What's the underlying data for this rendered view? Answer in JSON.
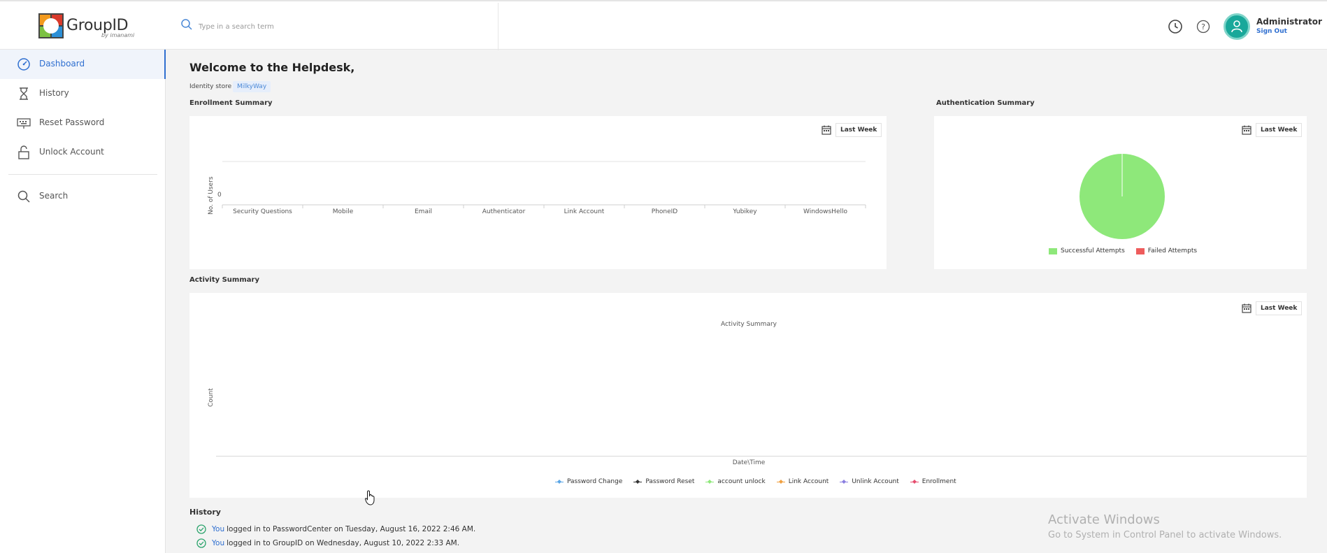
{
  "brand": {
    "name": "GroupID",
    "by": "by imanami"
  },
  "search": {
    "placeholder": "Type in a search term"
  },
  "user": {
    "name": "Administrator",
    "sign_out": "Sign Out"
  },
  "icons": {
    "history": "clock-icon",
    "help": "help-icon",
    "avatar": "user-icon"
  },
  "colors": {
    "accent": "#2f6fd0",
    "success": "#8ee87a",
    "failed": "#ee5c5c",
    "avatar": "#19a89a"
  },
  "sidebar": {
    "items": [
      {
        "label": "Dashboard",
        "icon": "dashboard-icon",
        "active": true
      },
      {
        "label": "History",
        "icon": "hourglass-icon",
        "active": false
      },
      {
        "label": "Reset Password",
        "icon": "keyboard-icon",
        "active": false
      },
      {
        "label": "Unlock Account",
        "icon": "unlock-icon",
        "active": false
      },
      {
        "label": "Search",
        "icon": "search-icon",
        "active": false
      }
    ]
  },
  "main": {
    "title": "Welcome to the Helpdesk,",
    "identity_store_label": "Identity store",
    "identity_store_value": "MilkyWay"
  },
  "enrollment": {
    "title": "Enrollment Summary",
    "range": "Last Week"
  },
  "authentication": {
    "title": "Authentication Summary",
    "range": "Last Week"
  },
  "activity": {
    "title": "Activity Summary",
    "range": "Last Week"
  },
  "chart_data": [
    {
      "type": "bar",
      "title": "",
      "ylabel": "No. of Users",
      "xlabel": "",
      "categories": [
        "Security Questions",
        "Mobile",
        "Email",
        "Authenticator",
        "Link Account",
        "PhoneID",
        "Yubikey",
        "WindowsHello"
      ],
      "values": [
        0,
        0,
        0,
        0,
        0,
        0,
        0,
        0
      ],
      "yticks": [
        "0"
      ]
    },
    {
      "type": "pie",
      "title": "",
      "labels": [
        "Successful Attempts",
        "Failed Attempts"
      ],
      "values": [
        100,
        0
      ],
      "colors": [
        "#8ee87a",
        "#ee5c5c"
      ],
      "legend": "bottom"
    },
    {
      "type": "line",
      "title": "Activity Summary",
      "xlabel": "Date\\Time",
      "ylabel": "Count",
      "legend": "bottom",
      "series": [
        {
          "name": "Password Change",
          "color": "#5aa6e6",
          "values": []
        },
        {
          "name": "Password Reset",
          "color": "#333333",
          "values": []
        },
        {
          "name": "account unlock",
          "color": "#8ee87a",
          "values": []
        },
        {
          "name": "Link Account",
          "color": "#f0a040",
          "values": []
        },
        {
          "name": "Unlink Account",
          "color": "#8a7ee0",
          "values": []
        },
        {
          "name": "Enrollment",
          "color": "#e64d6e",
          "values": []
        }
      ]
    }
  ],
  "history": {
    "title": "History",
    "entries": [
      {
        "actor": "You",
        "text": "logged in to PasswordCenter on Tuesday, August 16, 2022 2:46 AM."
      },
      {
        "actor": "You",
        "text": "logged in to GroupID on Wednesday, August 10, 2022 2:33 AM."
      }
    ]
  },
  "watermark": {
    "line1": "Activate Windows",
    "line2": "Go to System in Control Panel to activate Windows."
  }
}
